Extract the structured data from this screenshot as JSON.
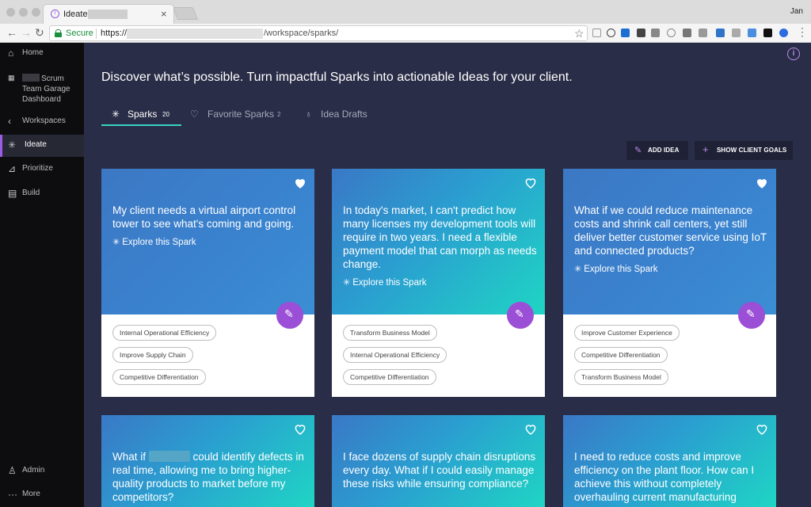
{
  "browser": {
    "tab_title": "Ideate |",
    "user": "Jan",
    "secure_label": "Secure",
    "url_prefix": "https://",
    "url_suffix": "/workspace/sparks/"
  },
  "sidebar": {
    "home": "Home",
    "dashboard": "Scrum Team Garage Dashboard",
    "workspaces": "Workspaces",
    "ideate": "Ideate",
    "prioritize": "Prioritize",
    "build": "Build",
    "admin": "Admin",
    "more": "More"
  },
  "main": {
    "headline": "Discover what’s possible. Turn impactful Sparks into actionable Ideas for your client.",
    "tabs": [
      {
        "label": "Sparks",
        "count": "20"
      },
      {
        "label": "Favorite Sparks",
        "count": "2"
      },
      {
        "label": "Idea Drafts",
        "count": ""
      }
    ],
    "add_idea": "ADD IDEA",
    "show_goals": "SHOW CLIENT GOALS",
    "explore_label": "Explore this Spark",
    "cards": [
      {
        "text": "My client needs a virtual airport control tower to see what's coming and going.",
        "tags": [
          "Internal Operational Efficiency",
          "Improve Supply Chain",
          "Competitive Differentiation"
        ],
        "favorite": true
      },
      {
        "text": "In today's market, I can't predict how many licenses my development tools will require in two years. I need a flexible payment model that can morph as needs change.",
        "tags": [
          "Transform Business Model",
          "Internal Operational Efficiency",
          "Competitive Differentiation"
        ],
        "favorite": false
      },
      {
        "text": "What if we could reduce maintenance costs and shrink call centers, yet still deliver better customer service using IoT and connected products?",
        "tags": [
          "Improve Customer Experience",
          "Competitive Differentiation",
          "Transform Business Model"
        ],
        "favorite": true
      },
      {
        "text_before": "What if",
        "text_after": "could identify defects in real time, allowing me to bring higher-quality products to market before my competitors?",
        "favorite": false
      },
      {
        "text": "I face dozens of supply chain disruptions every day. What if I could easily manage these risks while ensuring compliance?",
        "favorite": false
      },
      {
        "text": "I need to reduce costs and improve efficiency on the plant floor. How can I achieve this without completely overhauling current manufacturing",
        "favorite": false
      }
    ]
  },
  "colors": {
    "accent_purple": "#9b4fd6",
    "accent_teal": "#37d3c3",
    "background": "#2a2d47",
    "sidebar": "#0d0d0f"
  }
}
